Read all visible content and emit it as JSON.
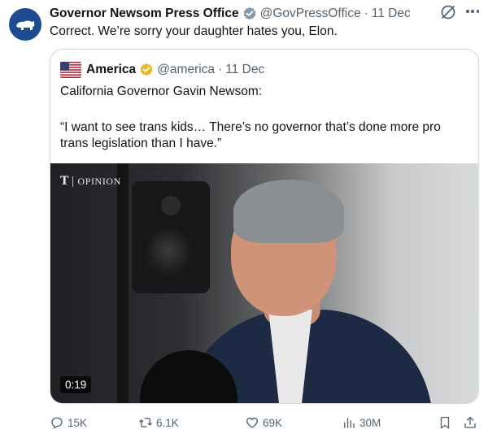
{
  "post": {
    "author_name": "Governor Newsom Press Office",
    "handle": "@GovPressOffice",
    "separator": "·",
    "date": "11 Dec",
    "text": "Correct. We’re sorry your daughter hates you, Elon."
  },
  "quoted": {
    "author_name": "America",
    "handle": "@america",
    "separator": "·",
    "date": "11 Dec",
    "line1": "California Governor Gavin Newsom:",
    "line2": "“I want to see trans kids… There’s no governor that’s done more pro trans legislation than I have.”",
    "video": {
      "watermark_logo": "T",
      "watermark_label": "OPINION",
      "duration": "0:19"
    }
  },
  "actions": {
    "replies": "15K",
    "reposts": "6.1K",
    "likes": "69K",
    "views": "30M"
  },
  "colors": {
    "verified_badge": "#829aab",
    "gold_badge": "#e8b829",
    "avatar_bg": "#1d4b8f",
    "muted_text": "#536471",
    "border": "#cfd9de"
  },
  "icons": [
    "california-bear-icon",
    "verified-badge-icon",
    "grok-icon",
    "more-icon",
    "us-flag-icon",
    "gold-verified-badge-icon",
    "reply-icon",
    "retweet-icon",
    "heart-icon",
    "views-icon",
    "bookmark-icon",
    "share-icon"
  ]
}
